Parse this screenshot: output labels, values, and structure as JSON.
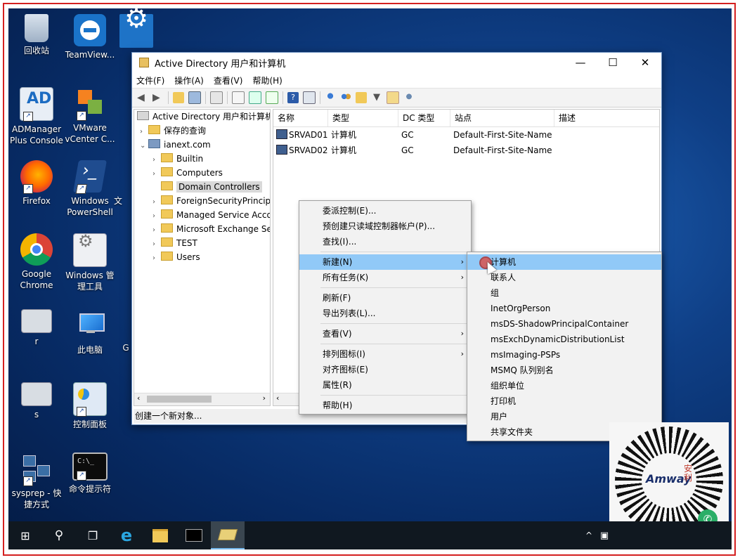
{
  "desktop_icons": [
    {
      "label": "回收站",
      "icon": "recycle-bin-icon"
    },
    {
      "label": "TeamView...",
      "icon": "teamviewer-icon"
    },
    {
      "label": "ADManager Plus Console",
      "icon": "admanager-icon"
    },
    {
      "label": "VMware vCenter C...",
      "icon": "vmware-icon"
    },
    {
      "label": "Firefox",
      "icon": "firefox-icon"
    },
    {
      "label": "Windows PowerShell",
      "icon": "powershell-icon"
    },
    {
      "label": "Google Chrome",
      "icon": "chrome-icon"
    },
    {
      "label": "Windows 管理工具",
      "icon": "admin-tools-icon"
    },
    {
      "label": "r",
      "icon": "window-icon"
    },
    {
      "label": "此电脑",
      "icon": "this-pc-icon"
    },
    {
      "label": "s",
      "icon": "window-icon"
    },
    {
      "label": "控制面板",
      "icon": "control-panel-icon"
    },
    {
      "label": "sysprep - 快捷方式",
      "icon": "network-icon"
    },
    {
      "label": "命令提示符",
      "icon": "cmd-icon"
    },
    {
      "label": "文",
      "icon": "partial-icon"
    },
    {
      "label": "G",
      "icon": "partial-icon"
    }
  ],
  "window": {
    "title": "Active Directory 用户和计算机",
    "menu": [
      "文件(F)",
      "操作(A)",
      "查看(V)",
      "帮助(H)"
    ],
    "tree": {
      "root": "Active Directory 用户和计算机",
      "saved_queries": "保存的查询",
      "domain": "ianext.com",
      "ous": [
        "Builtin",
        "Computers",
        "Domain Controllers",
        "ForeignSecurityPrincipa",
        "Managed Service Acco",
        "Microsoft Exchange Se",
        "TEST",
        "Users"
      ]
    },
    "columns": [
      "名称",
      "类型",
      "DC 类型",
      "站点",
      "描述"
    ],
    "rows": [
      {
        "name": "SRVAD01",
        "type": "计算机",
        "dc_type": "GC",
        "site": "Default-First-Site-Name",
        "desc": ""
      },
      {
        "name": "SRVAD02",
        "type": "计算机",
        "dc_type": "GC",
        "site": "Default-First-Site-Name",
        "desc": ""
      }
    ],
    "status": "创建一个新对象..."
  },
  "context_menu": {
    "items": [
      "委派控制(E)...",
      "预创建只读域控制器帐户(P)...",
      "查找(I)...",
      "新建(N)",
      "所有任务(K)",
      "刷新(F)",
      "导出列表(L)...",
      "查看(V)",
      "排列图标(I)",
      "对齐图标(E)",
      "属性(R)",
      "帮助(H)"
    ]
  },
  "submenu": {
    "items": [
      "计算机",
      "联系人",
      "组",
      "InetOrgPerson",
      "msDS-ShadowPrincipalContainer",
      "msExchDynamicDistributionList",
      "msImaging-PSPs",
      "MSMQ 队列别名",
      "组织单位",
      "打印机",
      "用户",
      "共享文件夹"
    ]
  },
  "overlay": {
    "brand": "Amway",
    "brand_glyph": "安利"
  },
  "colors": {
    "highlight": "#91c9f7",
    "frame": "#d42020",
    "taskbar": "#101820"
  }
}
